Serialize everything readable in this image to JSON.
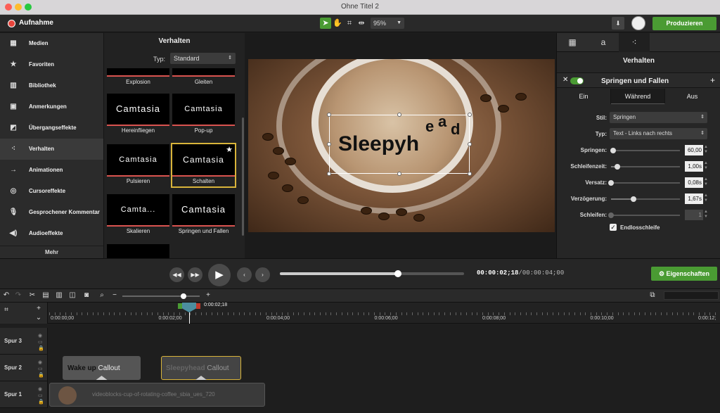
{
  "window": {
    "title": "Ohne Titel 2"
  },
  "toolbar": {
    "record_label": "Aufnahme",
    "zoom": "95%",
    "produce_label": "Produzieren"
  },
  "sidebar": {
    "items": [
      {
        "label": "Medien",
        "icon": "film-icon"
      },
      {
        "label": "Favoriten",
        "icon": "star-icon"
      },
      {
        "label": "Bibliothek",
        "icon": "books-icon"
      },
      {
        "label": "Anmerkungen",
        "icon": "annotation-icon"
      },
      {
        "label": "Übergangseffekte",
        "icon": "transition-icon"
      },
      {
        "label": "Verhalten",
        "icon": "behaviors-icon"
      },
      {
        "label": "Animationen",
        "icon": "arrow-icon"
      },
      {
        "label": "Cursoreffekte",
        "icon": "cursor-icon"
      },
      {
        "label": "Gesprochener Kommentar",
        "icon": "microphone-icon"
      },
      {
        "label": "Audioeffekte",
        "icon": "speaker-icon"
      }
    ],
    "more_label": "Mehr"
  },
  "library": {
    "title": "Verhalten",
    "type_label": "Typ:",
    "type_value": "Standard",
    "tiles": [
      {
        "caption": "Explosion",
        "text": ""
      },
      {
        "caption": "Gleiten",
        "text": ""
      },
      {
        "caption": "Hereinfliegen",
        "text": "Camtasia"
      },
      {
        "caption": "Pop-up",
        "text": "Camtasia"
      },
      {
        "caption": "Pulsieren",
        "text": "Camtasia"
      },
      {
        "caption": "Schalten",
        "text": "Camtasia"
      },
      {
        "caption": "Skalieren",
        "text": "Camta..."
      },
      {
        "caption": "Springen und Fallen",
        "text": "Camtasia"
      }
    ]
  },
  "canvas": {
    "text_main": "Sleepyh",
    "text_chars": [
      "e",
      "a",
      "d"
    ]
  },
  "properties": {
    "title": "Verhalten",
    "behavior_name": "Springen und Fallen",
    "segments": [
      "Ein",
      "Während",
      "Aus"
    ],
    "style_label": "Stil:",
    "style_value": "Springen",
    "type_label": "Typ:",
    "type_value": "Text - Links nach rechts",
    "sliders": [
      {
        "label": "Springen:",
        "value": "60,00",
        "level": 0.03
      },
      {
        "label": "Schleifenzeit:",
        "value": "1,00s",
        "level": 0.09
      },
      {
        "label": "Versatz:",
        "value": "0,08s",
        "level": 0.0
      },
      {
        "label": "Verzögerung:",
        "value": "1,67s",
        "level": 0.33
      },
      {
        "label": "Schleifen:",
        "value": "1",
        "level": 0.0
      }
    ],
    "loop_label": "Endlosschleife"
  },
  "transport": {
    "timecode_current": "00:00:02;18",
    "timecode_total": "/00:00:04;00",
    "progress": 0.64,
    "props_button": "Eigenschaften"
  },
  "timeline": {
    "playhead_label": "0:00:02;18",
    "ruler": [
      "0:00:00;00",
      "0:00:02;00",
      "0:00:04;00",
      "0:00:06;00",
      "0:00:08;00",
      "0:00:10;00",
      "0:00:12;"
    ],
    "tracks": [
      "Spur 3",
      "Spur 2",
      "Spur 1"
    ],
    "clips": {
      "clip1_bold": "Wake up",
      "clip1_text": "Callout",
      "clip2_bold": "Sleepyhead",
      "clip2_text": "Callout",
      "video": "videoblocks-cup-of-rotating-coffee_sbia_ues_720"
    }
  },
  "colors": {
    "accent_green": "#4a9b33",
    "selection_gold": "#d9b43a",
    "underline_red": "#d9534f"
  }
}
